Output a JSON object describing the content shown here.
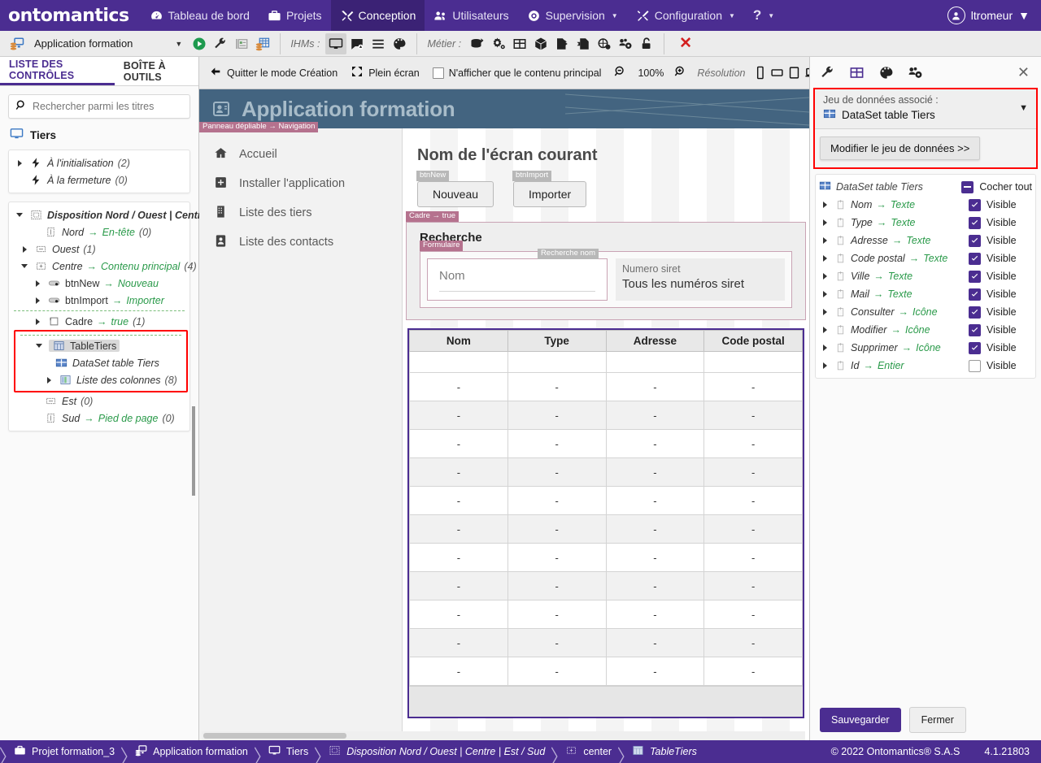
{
  "topnav": {
    "brand": "ontomantics",
    "items": [
      {
        "label": "Tableau de bord",
        "icon": "dashboard-icon",
        "caret": false,
        "active": false
      },
      {
        "label": "Projets",
        "icon": "toolbox-icon",
        "caret": false,
        "active": false
      },
      {
        "label": "Conception",
        "icon": "design-icon",
        "caret": false,
        "active": true
      },
      {
        "label": "Utilisateurs",
        "icon": "users-icon",
        "caret": false,
        "active": false
      },
      {
        "label": "Supervision",
        "icon": "eye-icon",
        "caret": true,
        "active": false
      },
      {
        "label": "Configuration",
        "icon": "tools-icon",
        "caret": true,
        "active": false
      },
      {
        "label": "?",
        "icon": "help-icon",
        "caret": true,
        "active": false
      }
    ],
    "user": "ltromeur"
  },
  "apptoolbar": {
    "app_name": "Application formation",
    "ihms_label": "IHMs :",
    "metier_label": "Métier :",
    "close_label": "✕"
  },
  "left": {
    "tabs": [
      {
        "label": "LISTE DES CONTRÔLES",
        "active": true
      },
      {
        "label": "BOÎTE À OUTILS",
        "active": false
      }
    ],
    "search_placeholder": "Rechercher parmi les titres",
    "search_value": "",
    "root_title": "Tiers",
    "events": [
      {
        "label": "À l'initialisation",
        "count": "(2)",
        "arrow": "right"
      },
      {
        "label": "À la fermeture",
        "count": "(0)",
        "arrow": "none"
      }
    ],
    "tree": [
      {
        "label": "Disposition Nord / Ouest | Centre |",
        "arrow": "down",
        "indent": 0,
        "icon": "layout-icon",
        "green": "",
        "count": ""
      },
      {
        "label": "Nord",
        "green": "En-tête",
        "count": "(0)",
        "arrow": "none",
        "indent": 1,
        "icon": "region-n-icon"
      },
      {
        "label": "Ouest",
        "green": "",
        "count": "(1)",
        "arrow": "right",
        "indent": 1,
        "icon": "region-w-icon"
      },
      {
        "label": "Centre",
        "green": "Contenu principal",
        "count": "(4)",
        "arrow": "down",
        "indent": 1,
        "icon": "region-c-icon"
      },
      {
        "label": "btnNew",
        "green": "Nouveau",
        "count": "",
        "arrow": "right",
        "indent": 2,
        "icon": "button-icon",
        "plain": true
      },
      {
        "label": "btnImport",
        "green": "Importer",
        "count": "",
        "arrow": "right",
        "indent": 2,
        "icon": "button-icon",
        "plain": true
      },
      {
        "label": "Cadre",
        "green": "true",
        "count": "(1)",
        "arrow": "right",
        "indent": 2,
        "icon": "frame-icon",
        "plain": true
      }
    ],
    "selected_group": [
      {
        "label": "TableTiers",
        "arrow": "down",
        "indent": 2,
        "icon": "table-icon",
        "selected": true
      },
      {
        "label": "DataSet table Tiers",
        "arrow": "none",
        "indent": 3,
        "icon": "dataset-icon"
      },
      {
        "label": "Liste des colonnes",
        "count": "(8)",
        "arrow": "right",
        "indent": 3,
        "icon": "columns-icon"
      }
    ],
    "tree_tail": [
      {
        "label": "Est",
        "green": "",
        "count": "(0)",
        "arrow": "none",
        "indent": 1,
        "icon": "region-e-icon"
      },
      {
        "label": "Sud",
        "green": "Pied de page",
        "count": "(0)",
        "arrow": "none",
        "indent": 1,
        "icon": "region-s-icon"
      }
    ]
  },
  "canvastoolbar": {
    "exit_label": "Quitter le mode Création",
    "fullscreen_label": "Plein écran",
    "maincontent_label": "N'afficher que le contenu principal",
    "maincontent_checked": false,
    "zoom_value": "100%",
    "resolution_label": "Résolution",
    "devices": [
      "phone-icon",
      "phone-landscape-icon",
      "tablet-icon",
      "laptop-icon",
      "desktop-icon"
    ],
    "selected_device": "desktop-icon"
  },
  "preview": {
    "header_title": "Application formation",
    "panel_tag": "Panneau dépliable → Navigation",
    "nav_links": [
      {
        "label": "Accueil",
        "icon": "home-icon"
      },
      {
        "label": "Installer l'application",
        "icon": "install-icon"
      },
      {
        "label": "Liste des tiers",
        "icon": "building-icon"
      },
      {
        "label": "Liste des contacts",
        "icon": "contact-icon"
      }
    ],
    "screen_title": "Nom de l'écran courant",
    "buttons": [
      {
        "tag": "btnNew",
        "label": "Nouveau"
      },
      {
        "tag": "btnImport",
        "label": "Importer"
      }
    ],
    "cadre_tag": "Cadre → true",
    "search_section_title": "Recherche",
    "form_tag": "Formulaire",
    "name_field_tag": "Recherche nom",
    "name_field_placeholder": "Nom",
    "siret_label": "Numero siret",
    "siret_value": "Tous les numéros siret",
    "table_columns": [
      "Nom",
      "Type",
      "Adresse",
      "Code postal"
    ],
    "table_rows": [
      [
        "-",
        "-",
        "-",
        "-"
      ],
      [
        "-",
        "-",
        "-",
        "-"
      ],
      [
        "-",
        "-",
        "-",
        "-"
      ],
      [
        "-",
        "-",
        "-",
        "-"
      ],
      [
        "-",
        "-",
        "-",
        "-"
      ],
      [
        "-",
        "-",
        "-",
        "-"
      ],
      [
        "-",
        "-",
        "-",
        "-"
      ],
      [
        "-",
        "-",
        "-",
        "-"
      ],
      [
        "-",
        "-",
        "-",
        "-"
      ],
      [
        "-",
        "-",
        "-",
        "-"
      ],
      [
        "-",
        "-",
        "-",
        "-"
      ]
    ]
  },
  "right": {
    "tools": [
      "wrench-icon",
      "table-icon",
      "palette-icon",
      "settings-group-icon"
    ],
    "close_label": "✕",
    "dataset_caption": "Jeu de données associé :",
    "dataset_value": "DataSet table Tiers",
    "modify_label": "Modifier le jeu de données >>",
    "list_header": "DataSet table Tiers",
    "check_all_label": "Cocher tout",
    "visible_label": "Visible",
    "fields": [
      {
        "name": "Nom",
        "type": "Texte",
        "visible": true
      },
      {
        "name": "Type",
        "type": "Texte",
        "visible": true
      },
      {
        "name": "Adresse",
        "type": "Texte",
        "visible": true
      },
      {
        "name": "Code postal",
        "type": "Texte",
        "visible": true
      },
      {
        "name": "Ville",
        "type": "Texte",
        "visible": true
      },
      {
        "name": "Mail",
        "type": "Texte",
        "visible": true
      },
      {
        "name": "Consulter",
        "type": "Icône",
        "visible": true
      },
      {
        "name": "Modifier",
        "type": "Icône",
        "visible": true
      },
      {
        "name": "Supprimer",
        "type": "Icône",
        "visible": true
      },
      {
        "name": "Id",
        "type": "Entier",
        "visible": false
      }
    ],
    "save_label": "Sauvegarder",
    "close_btn_label": "Fermer"
  },
  "bottombar": {
    "crumbs": [
      {
        "label": "Projet formation_3",
        "icon": "toolbox-icon",
        "italic": false
      },
      {
        "label": "Application formation",
        "icon": "app-icon",
        "italic": false
      },
      {
        "label": "Tiers",
        "icon": "screen-icon",
        "italic": false
      },
      {
        "label": "Disposition Nord / Ouest | Centre | Est / Sud",
        "icon": "layout-icon",
        "italic": true
      },
      {
        "label": "center",
        "icon": "region-c-icon",
        "italic": false
      },
      {
        "label": "TableTiers",
        "icon": "table-icon",
        "italic": true
      }
    ],
    "copyright": "© 2022 Ontomantics® S.A.S",
    "version": "4.1.21803"
  },
  "colors": {
    "brand_purple": "#4b2d91",
    "accent_green": "#2a9a4a",
    "highlight_red": "#ff0000",
    "header_blue": "#436480",
    "tag_pink": "#b5728e"
  }
}
